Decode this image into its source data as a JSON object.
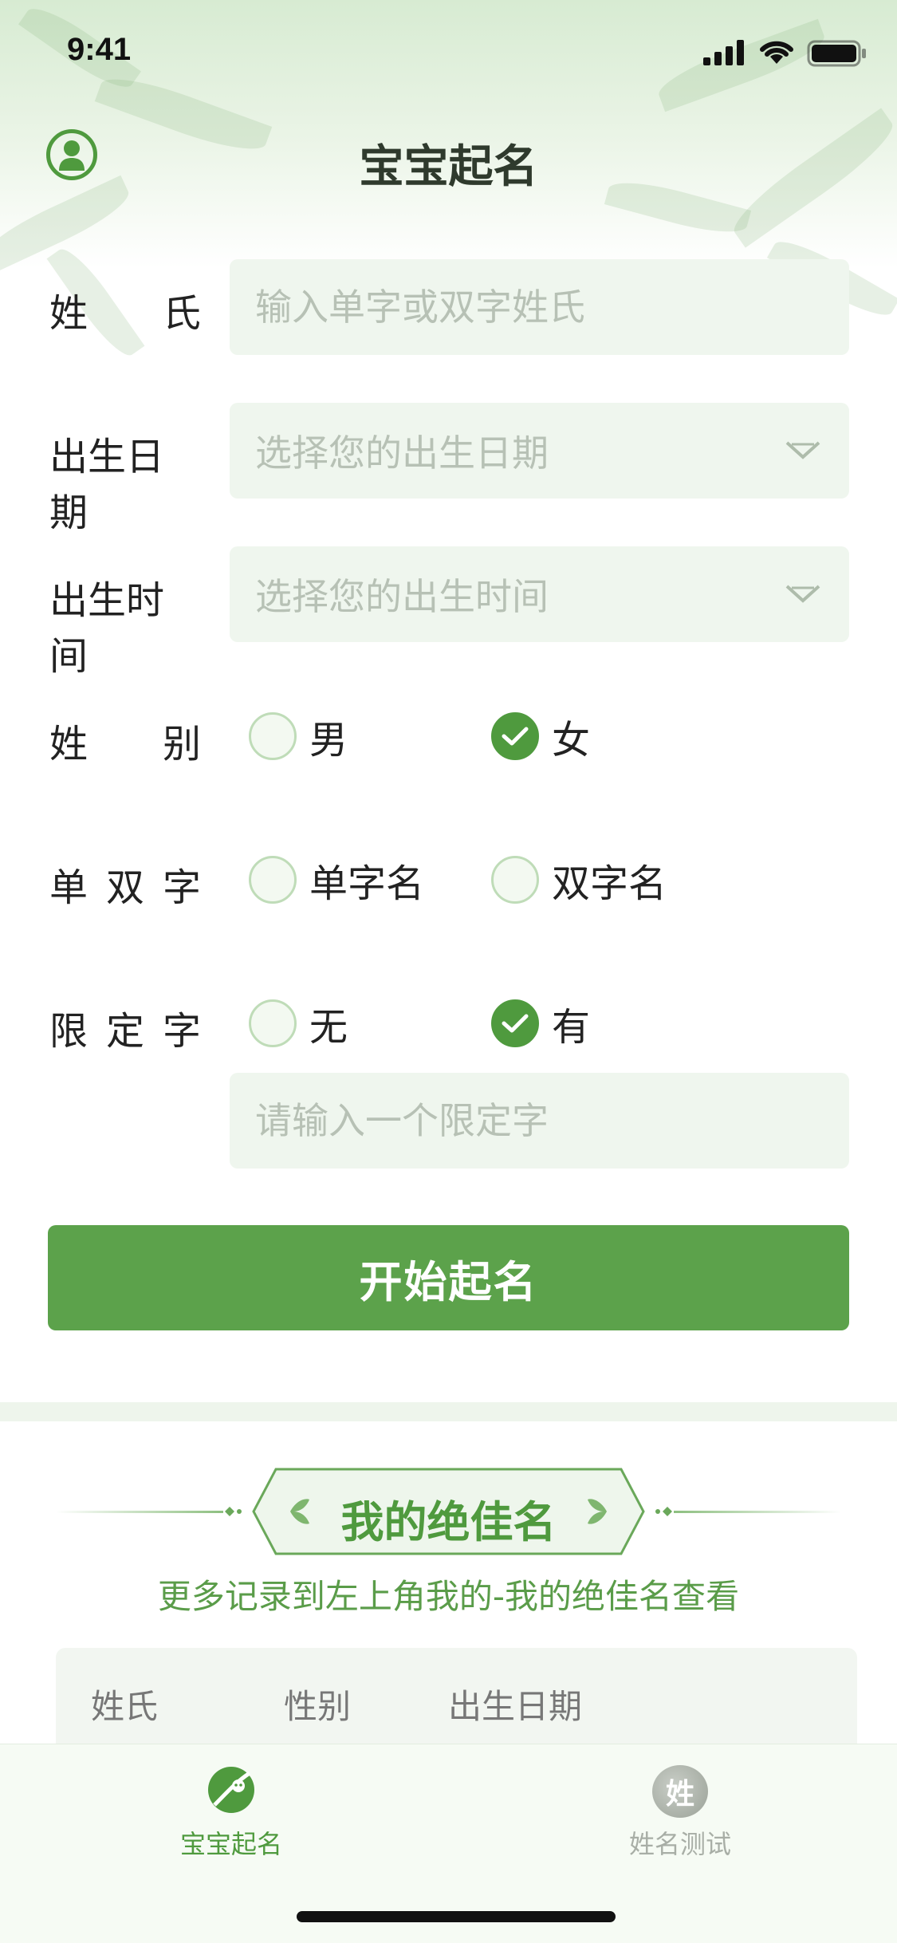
{
  "status_bar": {
    "time": "9:41"
  },
  "nav": {
    "title": "宝宝起名",
    "profile_icon": "user-circle-icon"
  },
  "form": {
    "surname": {
      "label_chars": [
        "姓",
        "氏"
      ],
      "placeholder": "输入单字或双字姓氏",
      "value": ""
    },
    "birth_date": {
      "label": "出生日期",
      "placeholder": "选择您的出生日期"
    },
    "birth_time": {
      "label": "出生时间",
      "placeholder": "选择您的出生时间"
    },
    "gender": {
      "label_chars": [
        "姓",
        "别"
      ],
      "options": [
        {
          "label": "男",
          "checked": false
        },
        {
          "label": "女",
          "checked": true
        }
      ]
    },
    "name_length": {
      "label_chars": [
        "单",
        "双",
        "字"
      ],
      "options": [
        {
          "label": "单字名",
          "checked": false
        },
        {
          "label": "双字名",
          "checked": false
        }
      ]
    },
    "fixed_char": {
      "label_chars": [
        "限",
        "定",
        "字"
      ],
      "options": [
        {
          "label": "无",
          "checked": false
        },
        {
          "label": "有",
          "checked": true
        }
      ],
      "input_placeholder": "请输入一个限定字"
    },
    "submit_label": "开始起名"
  },
  "favorites": {
    "title": "我的绝佳名",
    "subtitle": "更多记录到左上角我的-我的绝佳名查看",
    "columns": [
      "姓氏",
      "性别",
      "出生日期"
    ]
  },
  "tabs": [
    {
      "label": "宝宝起名",
      "active": true,
      "icon": "baby-naming-icon"
    },
    {
      "label": "姓名测试",
      "active": false,
      "icon": "name-test-icon",
      "icon_char": "姓"
    }
  ],
  "colors": {
    "primary": "#5ca24b",
    "accent_text": "#4f9a3e",
    "field_bg": "#eff6ee",
    "placeholder": "#b7c1b5",
    "inactive_tab": "#a8aea6"
  }
}
